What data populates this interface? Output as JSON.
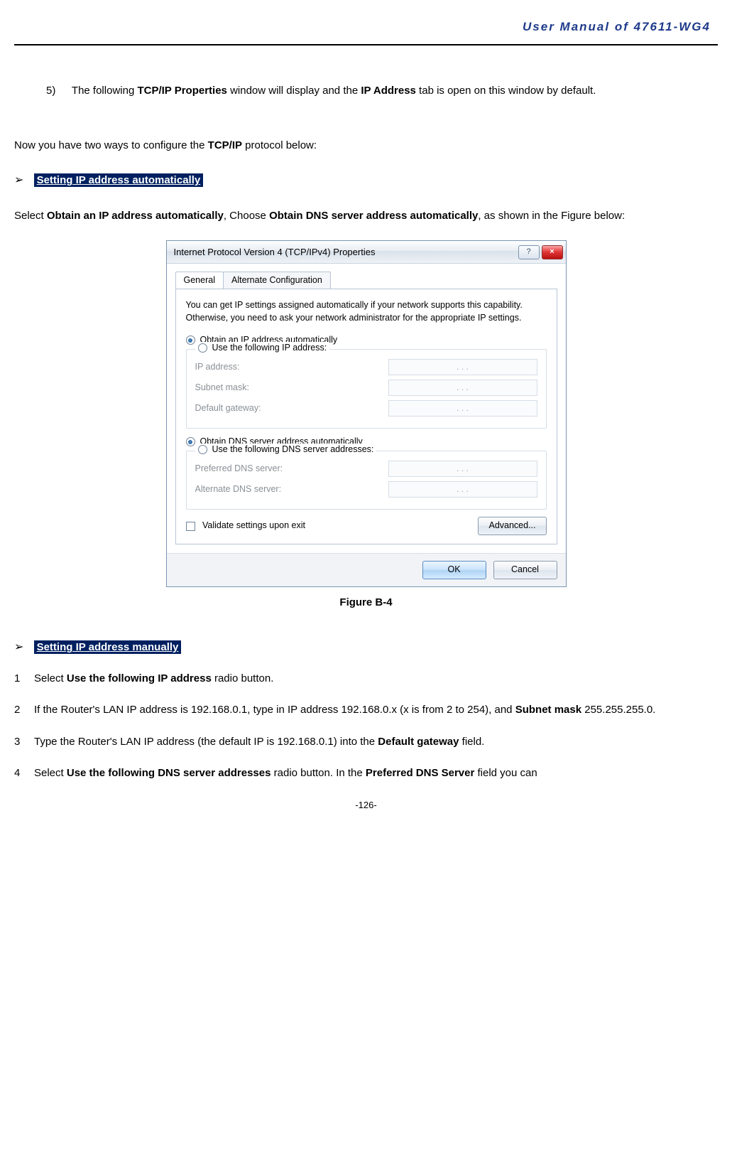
{
  "header": {
    "title": "User Manual of 47611-WG4"
  },
  "step5": {
    "num": "5)",
    "pre": "The following ",
    "b1": "TCP/IP Properties",
    "mid": " window will display and the ",
    "b2": "IP Address",
    "post": " tab is open on this window by default."
  },
  "intro": {
    "pre": "Now you have two ways to configure the ",
    "b": "TCP/IP",
    "post": " protocol below:"
  },
  "heading_auto": "Setting IP address automatically",
  "auto_para": {
    "pre": "Select ",
    "b1": "Obtain an IP address automatically",
    "mid": ", Choose ",
    "b2": "Obtain DNS server address automatically",
    "post": ", as shown in the Figure below:"
  },
  "dialog": {
    "title": "Internet Protocol Version 4 (TCP/IPv4) Properties",
    "help_icon": "?",
    "close_icon": "×",
    "tabs": {
      "general": "General",
      "alt": "Alternate Configuration"
    },
    "desc": "You can get IP settings assigned automatically if your network supports this capability. Otherwise, you need to ask your network administrator for the appropriate IP settings.",
    "r_auto_ip": "Obtain an IP address automatically",
    "r_use_ip": "Use the following IP address:",
    "f_ip": "IP address:",
    "f_subnet": "Subnet mask:",
    "f_gw": "Default gateway:",
    "r_auto_dns": "Obtain DNS server address automatically",
    "r_use_dns": "Use the following DNS server addresses:",
    "f_pdns": "Preferred DNS server:",
    "f_adns": "Alternate DNS server:",
    "chk_validate": "Validate settings upon exit",
    "btn_adv": "Advanced...",
    "btn_ok": "OK",
    "btn_cancel": "Cancel",
    "dots": ".       .       ."
  },
  "figure_caption": "Figure B-4",
  "heading_manual": "Setting IP address manually",
  "m1": {
    "num": "1",
    "pre": "Select ",
    "b": "Use the following IP address",
    "post": " radio button."
  },
  "m2": {
    "num": "2",
    "text1": "If the Router's LAN IP address is 192.168.0.1, type in IP address 192.168.0.x (x is from 2 to 254), and ",
    "b": "Subnet mask",
    "text2": " 255.255.255.0."
  },
  "m3": {
    "num": "3",
    "pre": "Type the Router's LAN IP address (the default IP is 192.168.0.1) into the ",
    "b": "Default gateway",
    "post": " field."
  },
  "m4": {
    "num": "4",
    "pre": "Select ",
    "b1": "Use the following DNS server addresses",
    "mid": " radio button. In the ",
    "b2": "Preferred DNS Server",
    "post": " field you can"
  },
  "page_num": "-126-"
}
